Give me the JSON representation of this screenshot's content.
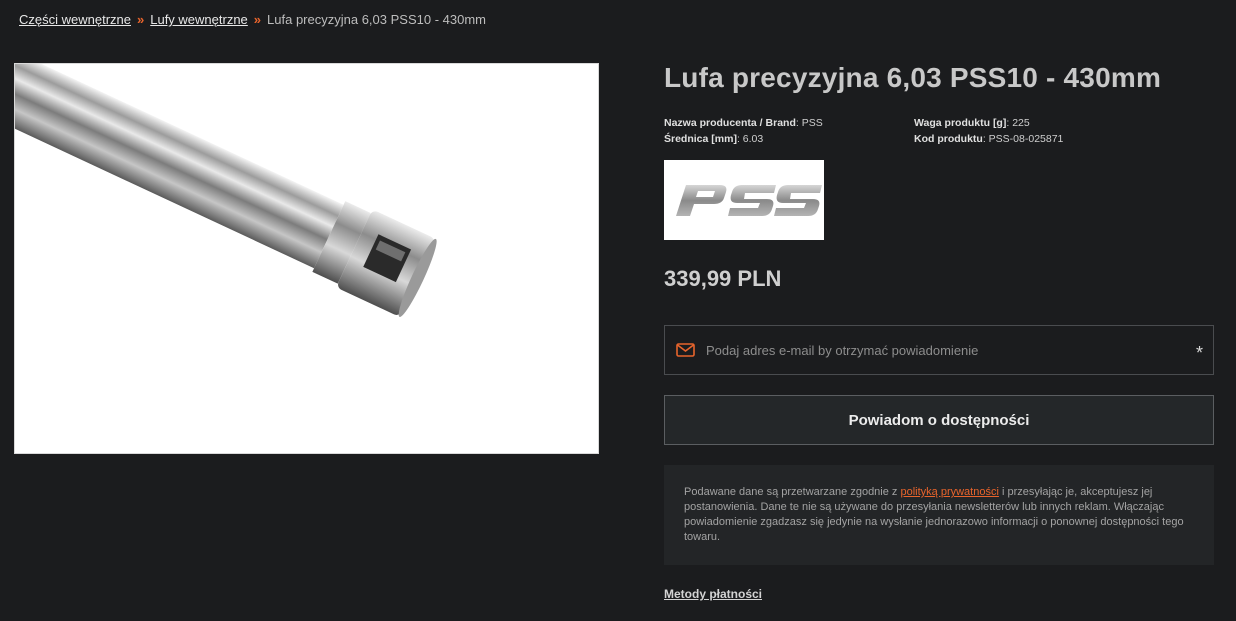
{
  "breadcrumb": {
    "items": [
      {
        "label": "Części wewnętrzne"
      },
      {
        "label": "Lufy wewnętrzne"
      }
    ],
    "current": "Lufa precyzyjna 6,03 PSS10 - 430mm",
    "separator": "»"
  },
  "product": {
    "title": "Lufa precyzyjna 6,03 PSS10 - 430mm",
    "attributes": {
      "brand_label": "Nazwa producenta / Brand",
      "brand_value": "PSS",
      "diameter_label": "Średnica [mm]",
      "diameter_value": "6.03",
      "weight_label": "Waga produktu [g]",
      "weight_value": "225",
      "code_label": "Kod produktu",
      "code_value": "PSS-08-025871"
    },
    "brand_logo_text": "PSS",
    "price": "339,99 PLN"
  },
  "notify": {
    "email_placeholder": "Podaj adres e-mail by otrzymać powiadomienie",
    "email_value": "",
    "required_mark": "*",
    "button_label": "Powiadom o dostępności"
  },
  "privacy": {
    "text_before": "Podawane dane są przetwarzane zgodnie z ",
    "link_label": "polityką prywatności",
    "text_after": " i przesyłając je, akceptujesz jej postanowienia. Dane te nie są używane do przesyłania newsletterów lub innych reklam. Włączając powiadomienie zgadzasz się jedynie na wysłanie jednorazowo informacji o ponownej dostępności tego towaru."
  },
  "payment_link": "Metody płatności",
  "colors": {
    "background": "#1b1c1e",
    "accent": "#e8642c"
  },
  "icons": {
    "email": "envelope-icon",
    "separator": "double-chevron-right-icon"
  }
}
